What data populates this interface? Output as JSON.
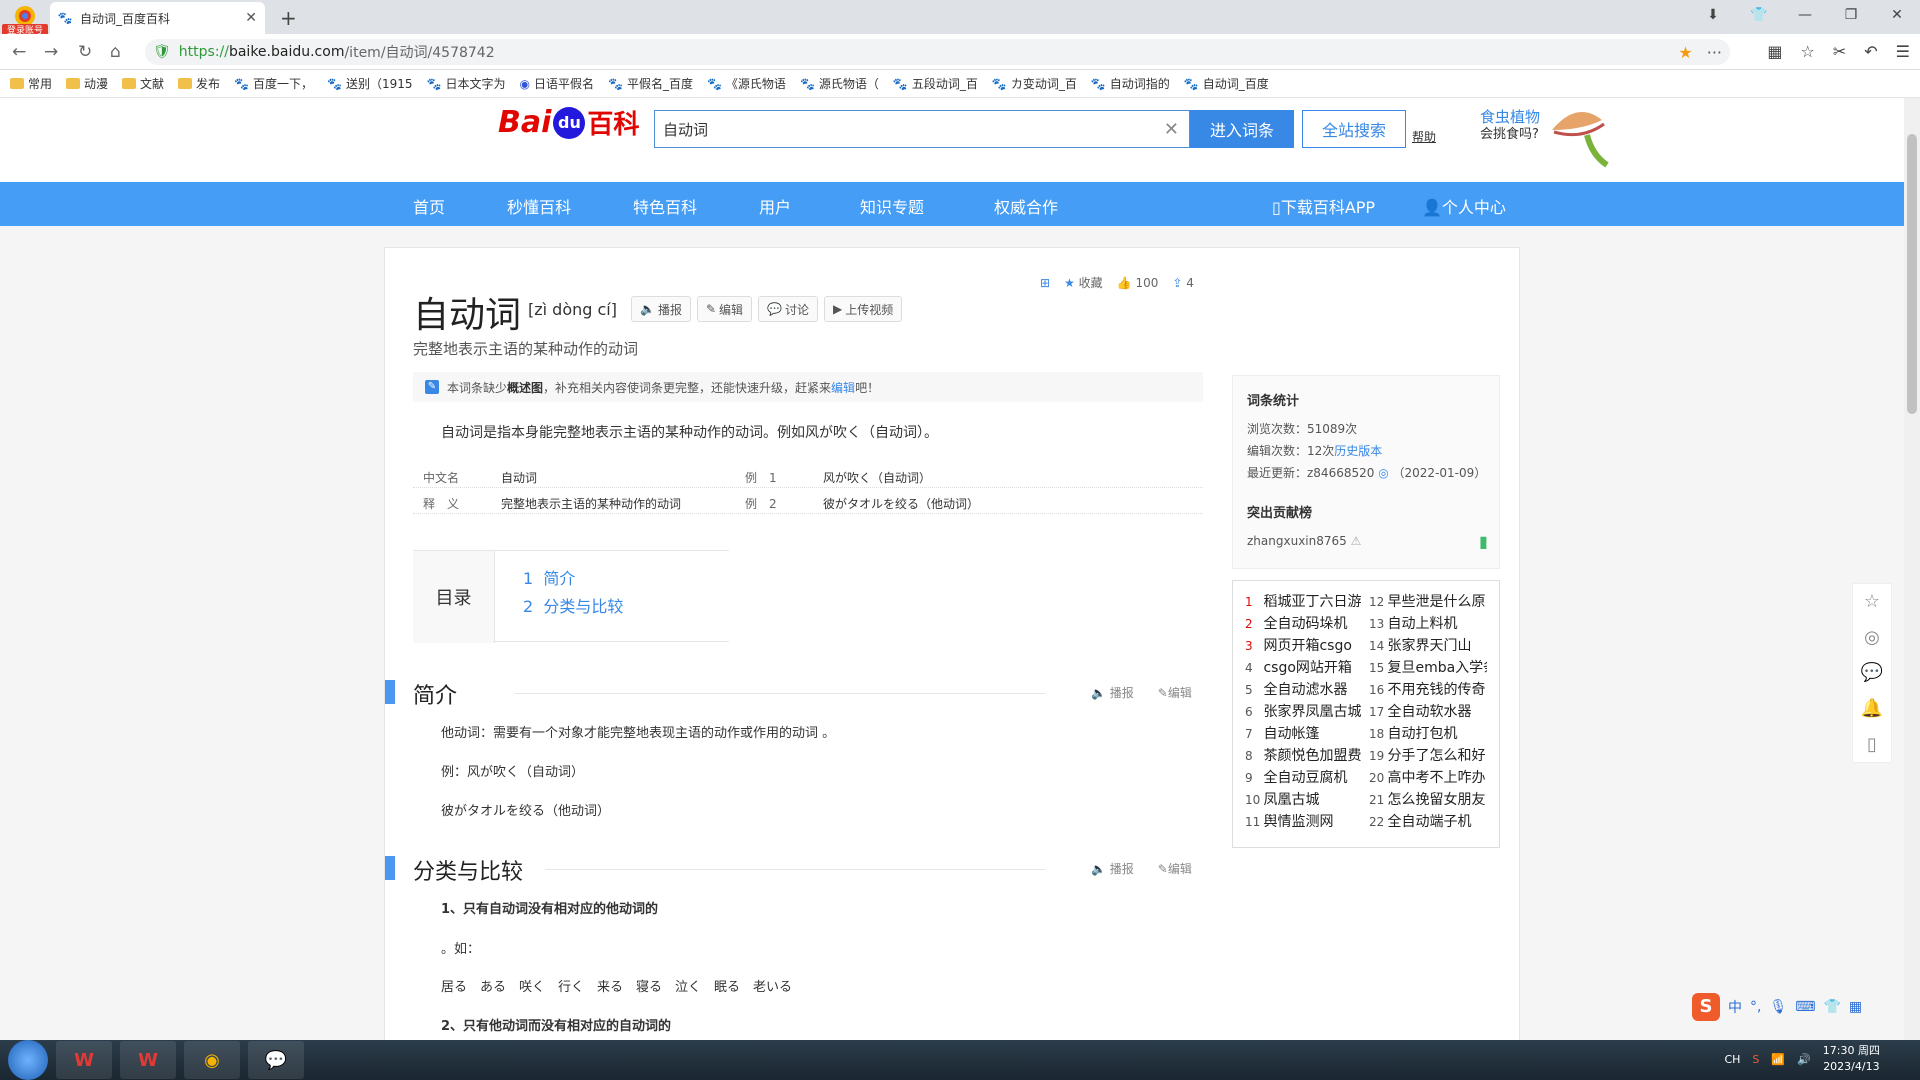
{
  "browser": {
    "brand_badge": "登录账号",
    "tab_title": "自动词_百度百科",
    "url_proto": "https://",
    "url_host": "baike.baidu.com",
    "url_path": "/item/自动词/4578742",
    "bookmarks": [
      "常用",
      "动漫",
      "文献",
      "发布",
      "百度一下，",
      "送别（1915",
      "日本文字为",
      "日语平假名",
      "平假名_百度",
      "《源氏物语",
      "源氏物语（",
      "五段动词_百",
      "カ变动词_百",
      "自动词指的",
      "自动词_百度"
    ]
  },
  "header": {
    "logo_bai": "Bai",
    "logo_du": "du",
    "logo_baike": "百科",
    "search_value": "自动词",
    "btn_enter": "进入词条",
    "btn_all": "全站搜索",
    "help": "帮助",
    "ad_line1": "食虫植物",
    "ad_line2": "会挑食吗?"
  },
  "nav": {
    "items": [
      "首页",
      "秒懂百科",
      "特色百科",
      "用户",
      "知识专题",
      "权威合作"
    ],
    "download": "下载百科APP",
    "personal": "个人中心"
  },
  "tools": {
    "collect": "收藏",
    "likes": "100",
    "shares": "4"
  },
  "entry": {
    "title": "自动词",
    "pinyin": "[zì dòng cí]",
    "actions": [
      "播报",
      "编辑",
      "讨论",
      "上传视频"
    ],
    "subtitle": "完整地表示主语的某种动作的动词",
    "notice_pre": "本词条缺少",
    "notice_bold": "概述图",
    "notice_mid": "，补充相关内容使词条更完整，还能快速升级，赶紧来",
    "notice_link": "编辑",
    "notice_post": "吧！",
    "summary": "自动词是指本身能完整地表示主语的某种动作的动词。例如风が吹く（自动词）。",
    "basic": [
      {
        "k1": "中文名",
        "v1": "自动词",
        "k2": "例　1",
        "v2": "风が吹く（自动词）"
      },
      {
        "k1": "释　义",
        "v1": "完整地表示主语的某种动作的动词",
        "k2": "例　2",
        "v2": "彼がタオルを绞る（他动词）"
      }
    ]
  },
  "toc": {
    "label": "目录",
    "items": [
      {
        "num": "1",
        "text": "简介"
      },
      {
        "num": "2",
        "text": "分类与比较"
      }
    ]
  },
  "sections": {
    "s1_title": "简介",
    "s2_title": "分类与比较",
    "read": "播报",
    "edit": "编辑",
    "s1_paras": [
      "他动词：需要有一个对象才能完整地表现主语的动作或作用的动词 。",
      "例：风が吹く（自动词）",
      "彼がタオルを绞る（他动词）"
    ],
    "s2_paras": [
      "1、只有自动词没有相对应的他动词的",
      "。如：",
      "居る　ある　咲く　行く　来る　寝る　泣く　眠る　老いる",
      "2、只有他动词而没有相对应的自动词的"
    ]
  },
  "stats": {
    "title": "词条统计",
    "views": "浏览次数：51089次",
    "edits_pre": "编辑次数：12次",
    "edits_link": "历史版本",
    "updated": "最近更新：z84668520",
    "updated_date": "（2022-01-09）",
    "contrib_title": "突出贡献榜",
    "contributor": "zhangxuxin8765"
  },
  "hot": [
    {
      "n": "1",
      "t": "稻城亚丁六日游"
    },
    {
      "n": "2",
      "t": "全自动码垛机"
    },
    {
      "n": "3",
      "t": "网页开箱csgo"
    },
    {
      "n": "4",
      "t": "csgo网站开箱"
    },
    {
      "n": "5",
      "t": "全自动滤水器"
    },
    {
      "n": "6",
      "t": "张家界凤凰古城"
    },
    {
      "n": "7",
      "t": "自动帐篷"
    },
    {
      "n": "8",
      "t": "茶颜悦色加盟费"
    },
    {
      "n": "9",
      "t": "全自动豆腐机"
    },
    {
      "n": "10",
      "t": "凤凰古城"
    },
    {
      "n": "11",
      "t": "舆情监测网"
    },
    {
      "n": "12",
      "t": "早些泄是什么原"
    },
    {
      "n": "13",
      "t": "自动上料机"
    },
    {
      "n": "14",
      "t": "张家界天门山"
    },
    {
      "n": "15",
      "t": "复旦emba入学条"
    },
    {
      "n": "16",
      "t": "不用充钱的传奇"
    },
    {
      "n": "17",
      "t": "全自动软水器"
    },
    {
      "n": "18",
      "t": "自动打包机"
    },
    {
      "n": "19",
      "t": "分手了怎么和好"
    },
    {
      "n": "20",
      "t": "高中考不上咋办"
    },
    {
      "n": "21",
      "t": "怎么挽留女朋友"
    },
    {
      "n": "22",
      "t": "全自动端子机"
    }
  ],
  "ime": {
    "cn": "中"
  },
  "taskbar": {
    "lang": "CH",
    "time": "17:30 周四",
    "date": "2023/4/13"
  }
}
